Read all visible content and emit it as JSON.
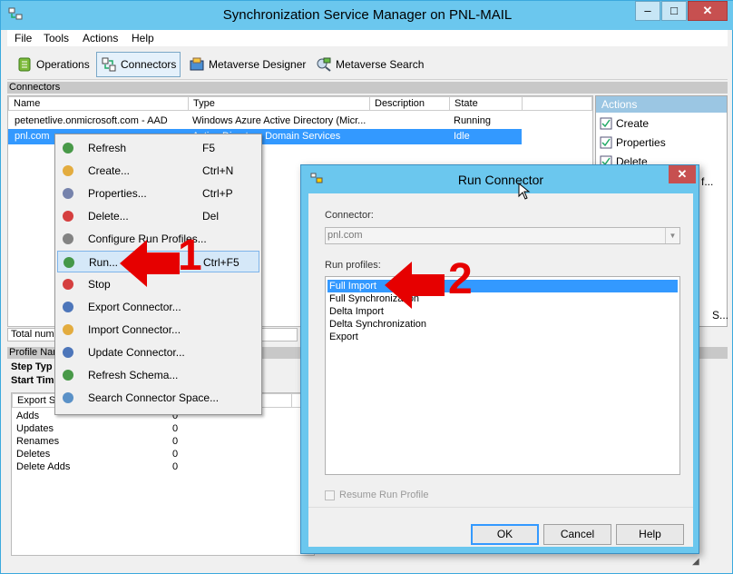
{
  "window": {
    "title": "Synchronization Service Manager on PNL-MAIL",
    "minimize": "‒",
    "maximize": "□",
    "close": "✕"
  },
  "menu": [
    "File",
    "Tools",
    "Actions",
    "Help"
  ],
  "toolbar": [
    "Operations",
    "Connectors",
    "Metaverse Designer",
    "Metaverse Search"
  ],
  "connectors": {
    "section_title": "Connectors",
    "columns": [
      "Name",
      "Type",
      "Description",
      "State"
    ],
    "rows": [
      {
        "name": "petenetlive.onmicrosoft.com - AAD",
        "type": "Windows Azure Active Directory (Micr...",
        "description": "",
        "state": "Running"
      },
      {
        "name": "pnl.com",
        "type": "Active Directory Domain Services",
        "description": "",
        "state": "Idle"
      }
    ]
  },
  "actions": {
    "title": "Actions",
    "items": [
      "Create",
      "Properties",
      "Delete"
    ],
    "partial_1": "f...",
    "partial_2": "S..."
  },
  "lower": {
    "total_label": "Total numb",
    "profile_header": "Profile Nan",
    "step_type": "Step Typ",
    "start_time": "Start Tim",
    "export_col": "Export St",
    "stats": [
      {
        "label": "Adds",
        "value": "0"
      },
      {
        "label": "Updates",
        "value": "0"
      },
      {
        "label": "Renames",
        "value": "0"
      },
      {
        "label": "Deletes",
        "value": "0"
      },
      {
        "label": "Delete Adds",
        "value": "0"
      }
    ]
  },
  "context_menu": [
    {
      "label": "Refresh",
      "key": "F5",
      "icon": "refresh-icon"
    },
    {
      "label": "Create...",
      "key": "Ctrl+N",
      "icon": "create-icon"
    },
    {
      "label": "Properties...",
      "key": "Ctrl+P",
      "icon": "properties-icon"
    },
    {
      "label": "Delete...",
      "key": "Del",
      "icon": "delete-icon"
    },
    {
      "label": "Configure Run Profiles...",
      "key": "",
      "icon": "configure-icon"
    },
    {
      "label": "Run...",
      "key": "Ctrl+F5",
      "icon": "run-icon"
    },
    {
      "label": "Stop",
      "key": "",
      "icon": "stop-icon"
    },
    {
      "label": "Export Connector...",
      "key": "",
      "icon": "export-icon"
    },
    {
      "label": "Import Connector...",
      "key": "",
      "icon": "import-icon"
    },
    {
      "label": "Update Connector...",
      "key": "",
      "icon": "update-icon"
    },
    {
      "label": "Refresh Schema...",
      "key": "",
      "icon": "refresh-schema-icon"
    },
    {
      "label": "Search Connector Space...",
      "key": "",
      "icon": "search-icon"
    }
  ],
  "dialog": {
    "title": "Run Connector",
    "connector_label": "Connector:",
    "connector_value": "pnl.com",
    "profiles_label": "Run profiles:",
    "profiles": [
      "Full Import",
      "Full Synchronization",
      "Delta Import",
      "Delta Synchronization",
      "Export"
    ],
    "selected_index": 0,
    "resume_label": "Resume Run Profile",
    "ok": "OK",
    "cancel": "Cancel",
    "help": "Help"
  },
  "annotations": {
    "step1": "1",
    "step2": "2",
    "arrow_color": "#e60000"
  },
  "colors": {
    "titlebar": "#6bc7ee",
    "selection": "#3399ff",
    "actions_header": "#9bc6e3"
  }
}
